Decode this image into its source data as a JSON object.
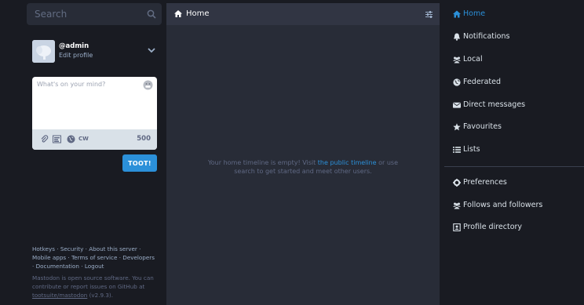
{
  "search": {
    "placeholder": "Search"
  },
  "account": {
    "handle": "@admin",
    "edit_label": "Edit profile"
  },
  "compose": {
    "placeholder": "What's on your mind?",
    "cw_label": "CW",
    "char_count": "500",
    "submit_label": "TOOT!"
  },
  "footer": {
    "links": [
      "Hotkeys",
      "Security",
      "About this server",
      "Mobile apps",
      "Terms of service",
      "Developers",
      "Documentation",
      "Logout"
    ],
    "about_prefix": "Mastodon is open source software. You can contribute or report issues on GitHub at ",
    "repo_link": "tootsuite/mastodon",
    "version": " (v2.9.3)."
  },
  "column": {
    "title": "Home",
    "empty_prefix": "Your home timeline is empty! Visit ",
    "empty_link": "the public timeline",
    "empty_suffix": " or use search to get started and meet other users."
  },
  "nav": {
    "items": [
      {
        "label": "Home",
        "icon": "home-icon",
        "active": true
      },
      {
        "label": "Notifications",
        "icon": "bell-icon"
      },
      {
        "label": "Local",
        "icon": "users-icon"
      },
      {
        "label": "Federated",
        "icon": "globe-icon"
      },
      {
        "label": "Direct messages",
        "icon": "envelope-icon"
      },
      {
        "label": "Favourites",
        "icon": "star-icon"
      },
      {
        "label": "Lists",
        "icon": "list-icon"
      }
    ],
    "secondary": [
      {
        "label": "Preferences",
        "icon": "gear-icon"
      },
      {
        "label": "Follows and followers",
        "icon": "users-icon"
      },
      {
        "label": "Profile directory",
        "icon": "address-book-icon"
      }
    ]
  },
  "colors": {
    "accent": "#2b90d9",
    "background": "#191b22",
    "panel": "#282c37"
  }
}
